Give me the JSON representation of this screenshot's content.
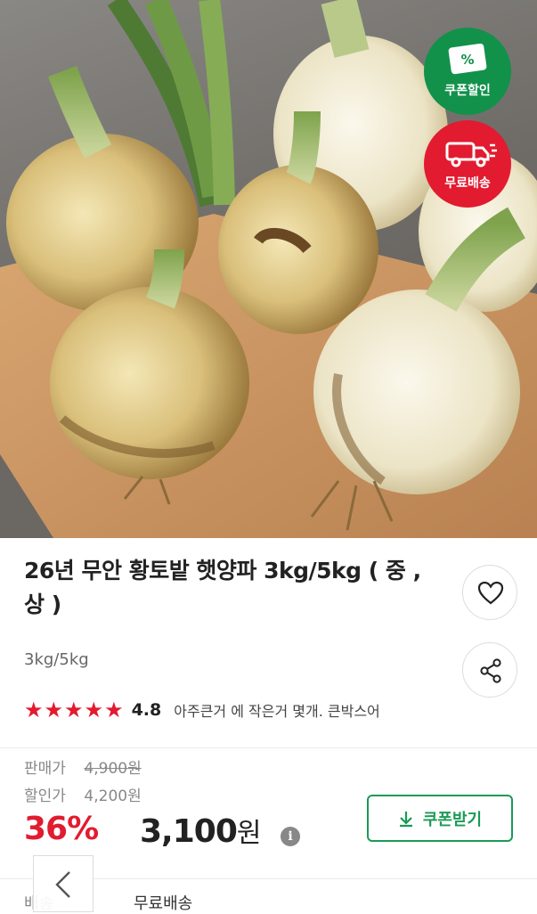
{
  "badges": {
    "coupon": "쿠폰할인",
    "coupon_symbol": "%",
    "shipping": "무료배송"
  },
  "product": {
    "title": "26년 무안 황토밭 햇양파 3kg/5kg ( 중 , 상 )",
    "option": "3kg/5kg",
    "rating": "4.8",
    "stars": 5,
    "review_snippet": "아주큰거 에 작은거 몇개. 큰박스어"
  },
  "price": {
    "sale_label": "판매가",
    "sale_value": "4,900원",
    "discount_label": "할인가",
    "discount_value": "4,200원",
    "discount_rate": "36%",
    "final_number": "3,100",
    "final_unit": "원",
    "info_symbol": "i"
  },
  "coupon_button": {
    "label": "쿠폰받기"
  },
  "shipping": {
    "label": "배송",
    "value": "무료배송"
  },
  "icons": [
    "heart-icon",
    "share-icon",
    "download-icon",
    "info-icon",
    "chevron-left-icon",
    "coupon-icon",
    "truck-icon"
  ],
  "colors": {
    "accent_green": "#12914a",
    "accent_red": "#e21b30"
  }
}
